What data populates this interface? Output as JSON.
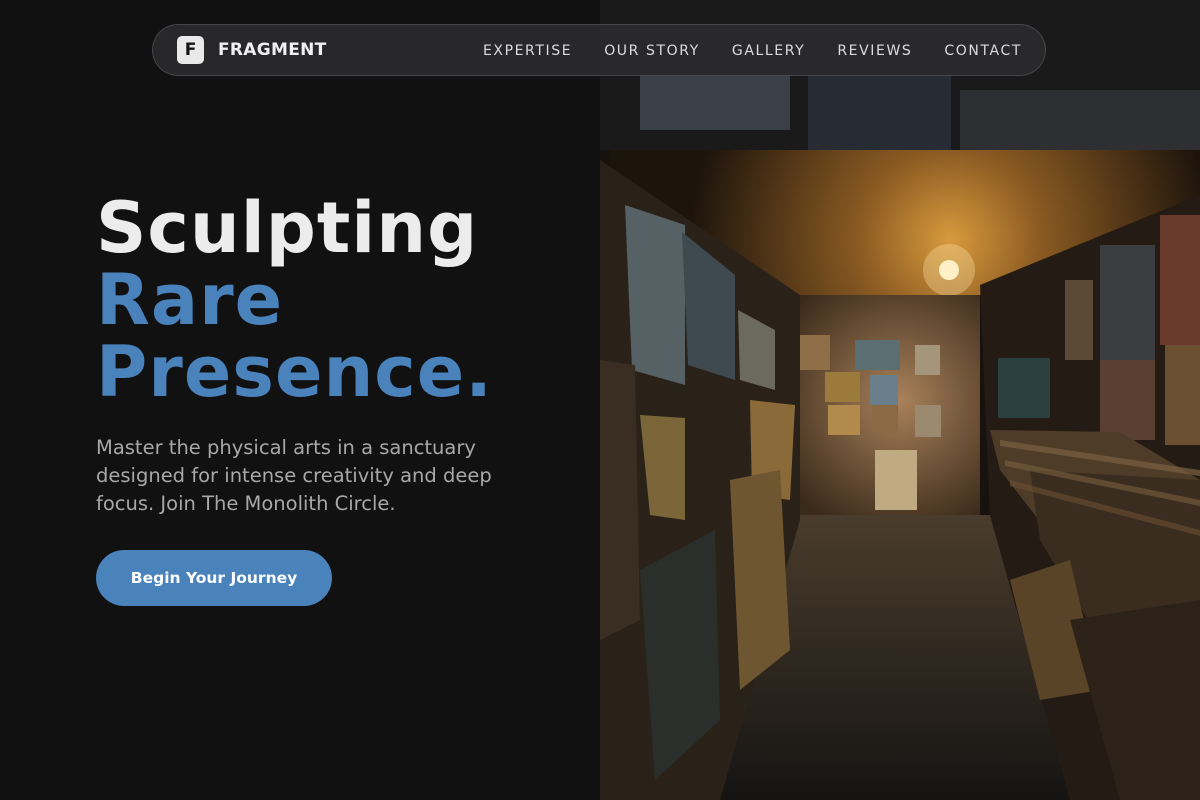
{
  "nav": {
    "brand_mark": "F",
    "brand_name": "FRAGMENT",
    "links": [
      "EXPERTISE",
      "OUR STORY",
      "GALLERY",
      "REVIEWS",
      "CONTACT"
    ]
  },
  "hero": {
    "title_line1": "Sculpting",
    "title_line2": "Rare",
    "title_line3": "Presence.",
    "description": "Master the physical arts in a sanctuary designed for intense creativity and deep focus. Join The Monolith Circle.",
    "cta_label": "Begin Your Journey"
  },
  "image": {
    "subject": "art-gallery-corridor-photo"
  },
  "colors": {
    "background": "#111112",
    "accent": "#4a82bb",
    "heading": "#ececec",
    "body_text": "#a8a8a8"
  }
}
